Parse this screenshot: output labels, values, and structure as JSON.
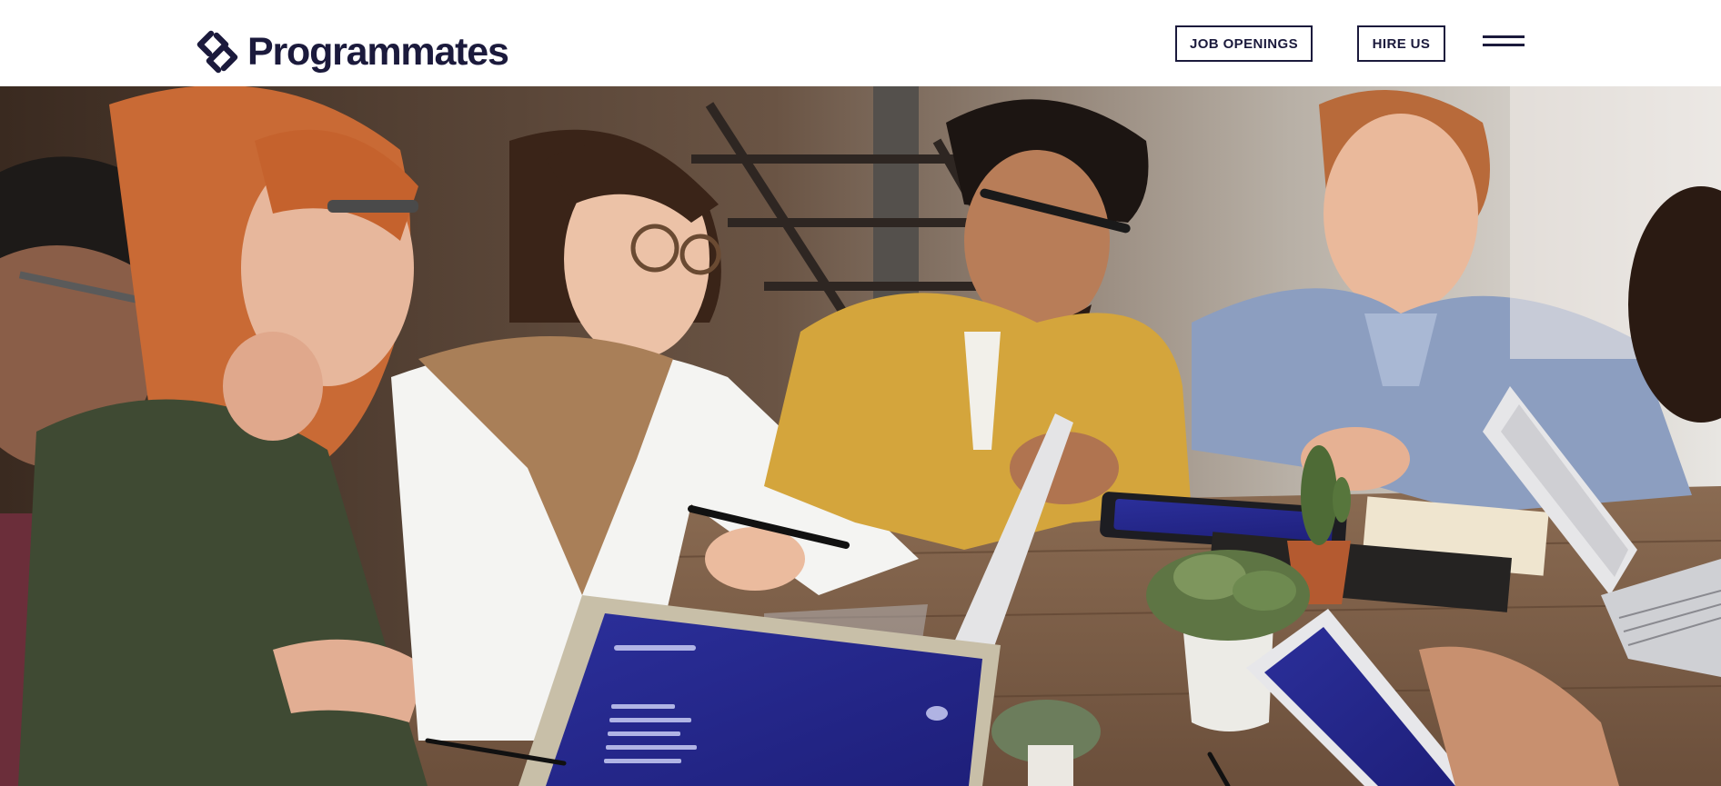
{
  "header": {
    "logo_text": "Programmates",
    "logo_icon": "s-mark-logo-icon",
    "job_openings_label": "JOB OPENINGS",
    "hire_us_label": "HIRE US",
    "menu_icon": "hamburger-menu-icon"
  },
  "hero": {
    "image": "team-meeting-photo",
    "description_visible_text": ""
  },
  "colors": {
    "brand_navy": "#1b1a3c",
    "background": "#ffffff"
  }
}
